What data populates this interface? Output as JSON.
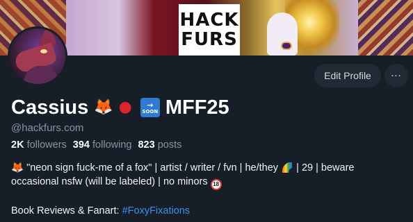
{
  "banner": {
    "logo_line1": "HACK",
    "logo_line2": "FURS"
  },
  "profile": {
    "display_name": "Cassius",
    "name_suffix": "MFF25",
    "soon_badge": {
      "arrow": "→",
      "text": "SOON"
    },
    "name_icons": [
      "fox-emoji-icon",
      "apple-emoji-icon",
      "soon-arrow-emoji-icon"
    ],
    "handle": "@hackfurs.com"
  },
  "actions": {
    "edit_label": "Edit Profile",
    "more_icon": "ellipsis-icon"
  },
  "stats": {
    "followers": {
      "count": "2K",
      "label": "followers"
    },
    "following": {
      "count": "394",
      "label": "following"
    },
    "posts": {
      "count": "823",
      "label": "posts"
    }
  },
  "bio": {
    "lead_icon": "🦊",
    "line1_part1": "\"neon sign fuck-me of a fox\" | artist / writer / fvn | he/they",
    "rainbow_icon": "🌈",
    "line1_part2": "| 29 | beware",
    "line2": "occasional nsfw (will be labeled) | no minors",
    "age_badge": "18",
    "line3_prefix": "Book Reviews & Fanart:",
    "hashtag": "#FoxyFixations"
  },
  "colors": {
    "background": "#161e27",
    "button_bg": "#1f2a35",
    "muted_text": "#8595a6",
    "link": "#3b8ff0"
  }
}
